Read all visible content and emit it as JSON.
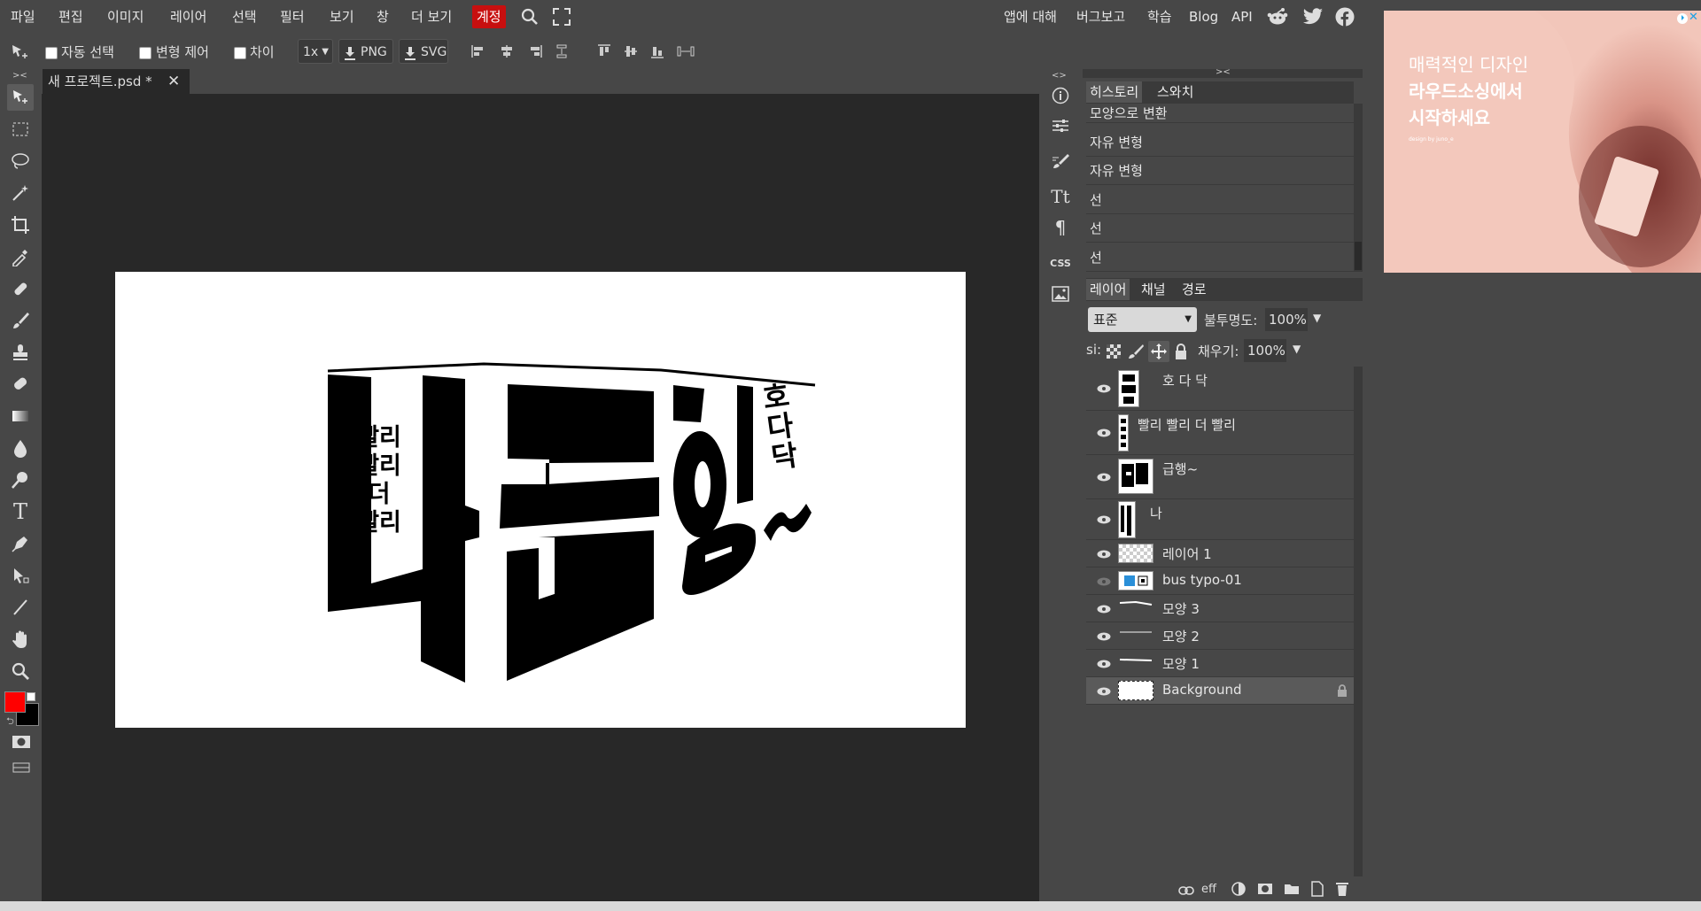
{
  "menu": {
    "items": [
      "파일",
      "편집",
      "이미지",
      "레이어",
      "선택",
      "필터",
      "보기",
      "창",
      "더 보기"
    ],
    "account": "계정",
    "right_links": [
      "앱에 대해",
      "버그보고",
      "학습",
      "Blog",
      "API"
    ]
  },
  "options": {
    "auto_select": "자동 선택",
    "transform_controls": "변형 제어",
    "distances": "차이",
    "zoom": "1x",
    "png": "PNG",
    "svg": "SVG"
  },
  "document": {
    "tab_title": "새 프로젝트.psd *"
  },
  "artwork": {
    "na": "나",
    "geup": "급",
    "haeng": "행",
    "tilde": "~",
    "side_text": [
      "빨리",
      "빨리",
      "더",
      "빨리"
    ],
    "hodadak": [
      "호",
      "다",
      "닥"
    ]
  },
  "history": {
    "tabs": [
      "히스토리",
      "스와치"
    ],
    "items": [
      "모양으로 변환",
      "자유 변형",
      "자유 변형",
      "선",
      "선",
      "선"
    ]
  },
  "layers": {
    "tabs": [
      "레이어",
      "채널",
      "경로"
    ],
    "blend_mode": "표준",
    "opacity_label": "불투명도:",
    "opacity_value": "100%",
    "lock_label": "si:",
    "fill_label": "채우기:",
    "fill_value": "100%",
    "items": [
      {
        "name": "호 다 닥"
      },
      {
        "name": "빨리 빨리 더 빨리"
      },
      {
        "name": "급행~"
      },
      {
        "name": "나"
      },
      {
        "name": "레이어 1"
      },
      {
        "name": "bus typo-01"
      },
      {
        "name": "모양 3"
      },
      {
        "name": "모양 2"
      },
      {
        "name": "모양 1"
      },
      {
        "name": "Background"
      }
    ],
    "footer_eff": "eff"
  },
  "ad": {
    "line1": "매력적인 디자인",
    "line2": "라우드소싱에서",
    "line3": "시작하세요",
    "credit": "design by juno_e"
  },
  "colors": {
    "foreground": "#ff0000",
    "background": "#000000",
    "accent": "#c70f0f"
  }
}
